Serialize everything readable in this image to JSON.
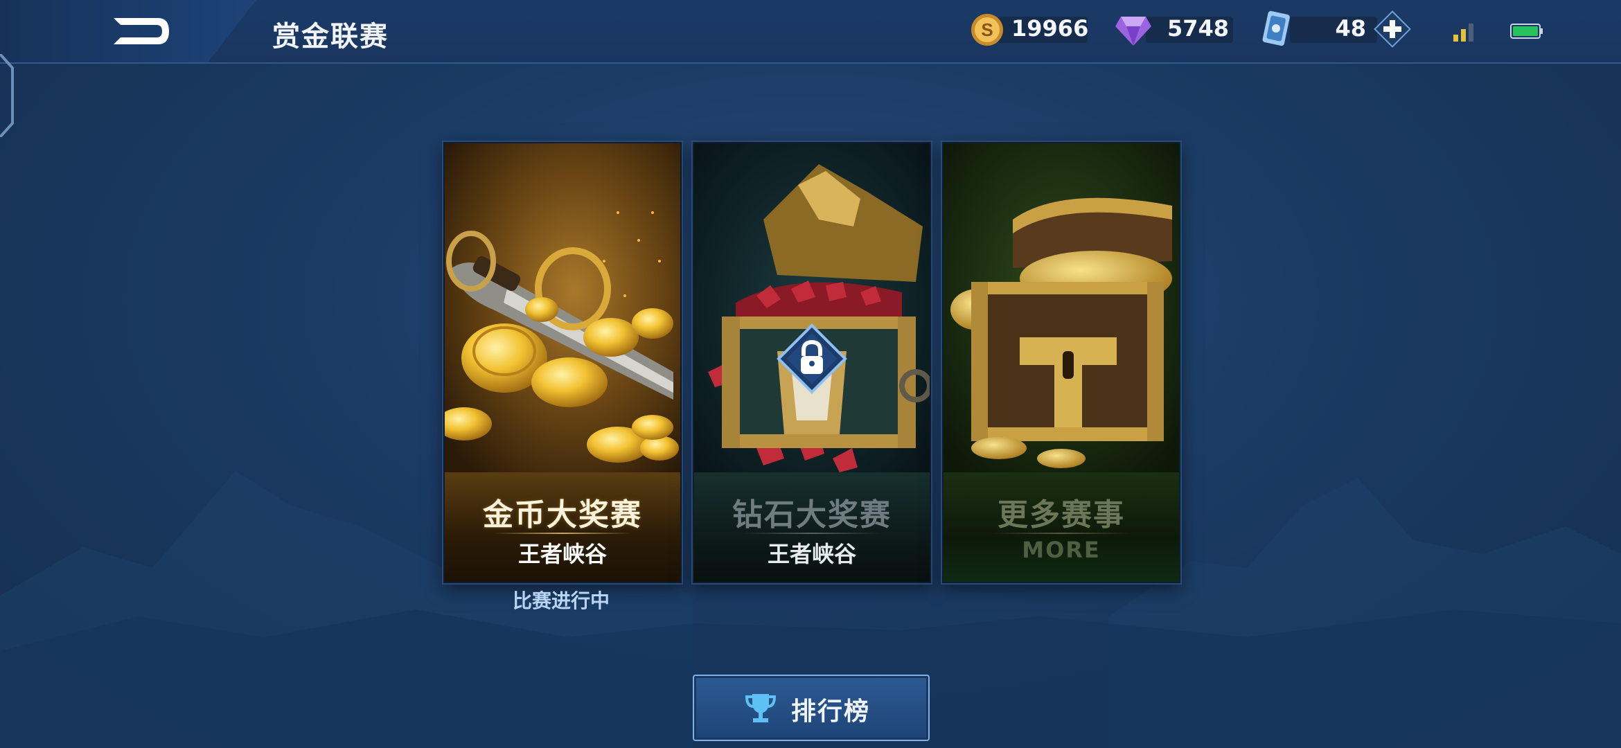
{
  "header": {
    "title": "赏金联赛",
    "gold": "19966",
    "diamonds": "5748",
    "tickets": "48"
  },
  "cards": [
    {
      "title": "金币大奖赛",
      "subtitle": "王者峡谷",
      "status": "比赛进行中",
      "locked": false
    },
    {
      "title": "钻石大奖赛",
      "subtitle": "王者峡谷",
      "locked": true
    },
    {
      "title": "更多赛事",
      "subtitle": "MORE",
      "locked": false
    }
  ],
  "ranking_button": {
    "label": "排行榜"
  },
  "colors": {
    "accent": "#7fb1e8",
    "gold_title": "#fbf3dc",
    "dim_title": "#8f9aa4",
    "battery": "#27c25e",
    "signal": "#e6c23a"
  },
  "icons": {
    "back": "back-arrow-icon",
    "gold": "gold-coin-icon",
    "diamond": "diamond-icon",
    "ticket": "ticket-card-icon",
    "add": "plus-icon",
    "lock": "lock-icon",
    "trophy": "trophy-icon"
  }
}
